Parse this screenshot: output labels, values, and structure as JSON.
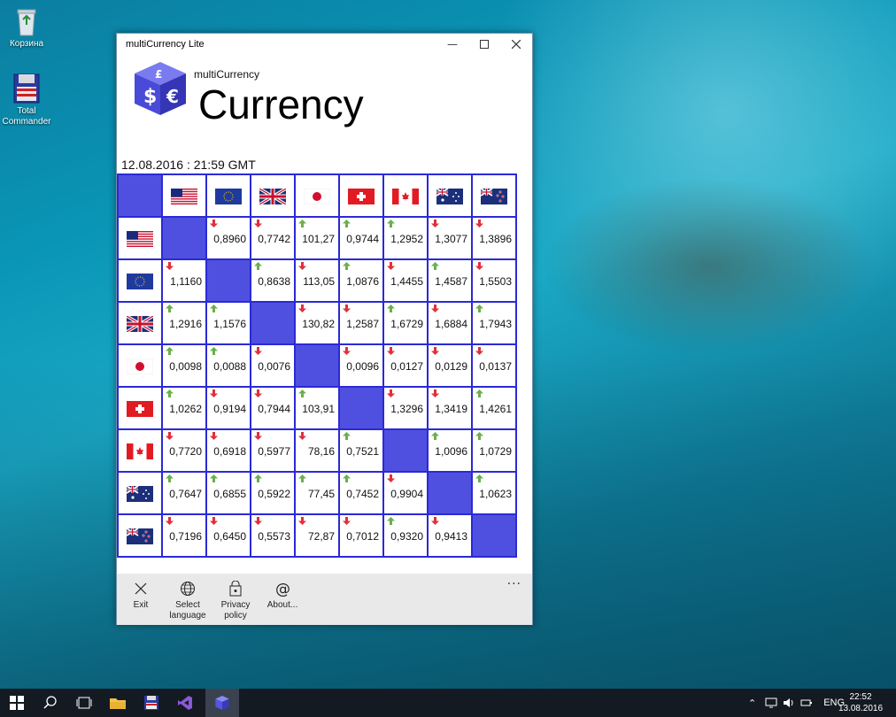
{
  "desktop": {
    "icons": [
      {
        "label": "Корзина"
      },
      {
        "label": "Total Commander"
      }
    ]
  },
  "window": {
    "title": "multiCurrency Lite",
    "app_subtitle": "multiCurrency",
    "app_title": "Currency",
    "timestamp": "12.08.2016 : 21:59 GMT"
  },
  "grid": {
    "currencies": [
      "USD",
      "EUR",
      "GBP",
      "JPY",
      "CHF",
      "CAD",
      "AUD",
      "NZD"
    ],
    "rows": [
      {
        "cells": [
          null,
          {
            "v": "0,8960",
            "d": "down"
          },
          {
            "v": "0,7742",
            "d": "down"
          },
          {
            "v": "101,27",
            "d": "up"
          },
          {
            "v": "0,9744",
            "d": "up"
          },
          {
            "v": "1,2952",
            "d": "up"
          },
          {
            "v": "1,3077",
            "d": "down"
          },
          {
            "v": "1,3896",
            "d": "down"
          }
        ]
      },
      {
        "cells": [
          {
            "v": "1,1160",
            "d": "down"
          },
          null,
          {
            "v": "0,8638",
            "d": "up"
          },
          {
            "v": "113,05",
            "d": "down"
          },
          {
            "v": "1,0876",
            "d": "up"
          },
          {
            "v": "1,4455",
            "d": "down"
          },
          {
            "v": "1,4587",
            "d": "up"
          },
          {
            "v": "1,5503",
            "d": "down"
          }
        ]
      },
      {
        "cells": [
          {
            "v": "1,2916",
            "d": "up"
          },
          {
            "v": "1,1576",
            "d": "up"
          },
          null,
          {
            "v": "130,82",
            "d": "down"
          },
          {
            "v": "1,2587",
            "d": "down"
          },
          {
            "v": "1,6729",
            "d": "up"
          },
          {
            "v": "1,6884",
            "d": "down"
          },
          {
            "v": "1,7943",
            "d": "up"
          }
        ]
      },
      {
        "cells": [
          {
            "v": "0,0098",
            "d": "up"
          },
          {
            "v": "0,0088",
            "d": "up"
          },
          {
            "v": "0,0076",
            "d": "down"
          },
          null,
          {
            "v": "0,0096",
            "d": "down"
          },
          {
            "v": "0,0127",
            "d": "down"
          },
          {
            "v": "0,0129",
            "d": "down"
          },
          {
            "v": "0,0137",
            "d": "down"
          }
        ]
      },
      {
        "cells": [
          {
            "v": "1,0262",
            "d": "up"
          },
          {
            "v": "0,9194",
            "d": "down"
          },
          {
            "v": "0,7944",
            "d": "down"
          },
          {
            "v": "103,91",
            "d": "up"
          },
          null,
          {
            "v": "1,3296",
            "d": "down"
          },
          {
            "v": "1,3419",
            "d": "down"
          },
          {
            "v": "1,4261",
            "d": "up"
          }
        ]
      },
      {
        "cells": [
          {
            "v": "0,7720",
            "d": "down"
          },
          {
            "v": "0,6918",
            "d": "down"
          },
          {
            "v": "0,5977",
            "d": "down"
          },
          {
            "v": "78,16",
            "d": "down"
          },
          {
            "v": "0,7521",
            "d": "up"
          },
          null,
          {
            "v": "1,0096",
            "d": "up"
          },
          {
            "v": "1,0729",
            "d": "up"
          }
        ]
      },
      {
        "cells": [
          {
            "v": "0,7647",
            "d": "up"
          },
          {
            "v": "0,6855",
            "d": "up"
          },
          {
            "v": "0,5922",
            "d": "up"
          },
          {
            "v": "77,45",
            "d": "up"
          },
          {
            "v": "0,7452",
            "d": "up"
          },
          {
            "v": "0,9904",
            "d": "down"
          },
          null,
          {
            "v": "1,0623",
            "d": "up"
          }
        ]
      },
      {
        "cells": [
          {
            "v": "0,7196",
            "d": "down"
          },
          {
            "v": "0,6450",
            "d": "down"
          },
          {
            "v": "0,5573",
            "d": "down"
          },
          {
            "v": "72,87",
            "d": "down"
          },
          {
            "v": "0,7012",
            "d": "down"
          },
          {
            "v": "0,9320",
            "d": "up"
          },
          {
            "v": "0,9413",
            "d": "down"
          },
          null
        ]
      }
    ]
  },
  "appbar": {
    "exit": "Exit",
    "language_1": "Select",
    "language_2": "language",
    "privacy_1": "Privacy",
    "privacy_2": "policy",
    "about": "About...",
    "more": "..."
  },
  "taskbar": {
    "language": "ENG",
    "time": "22:52",
    "date": "13.08.2016"
  },
  "colors": {
    "grid_border": "#2a2ad6",
    "diag_fill": "#5050e0",
    "arrow_up": "#6ab04c",
    "arrow_down": "#e0303a"
  }
}
